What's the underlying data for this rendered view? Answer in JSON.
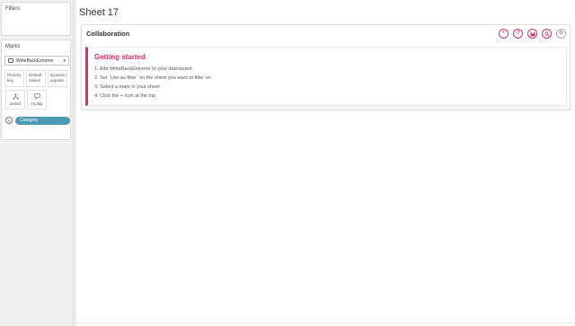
{
  "left_panel": {
    "filters_title": "Filters",
    "marks_title": "Marks",
    "mark_type": "WriteBackExtreme",
    "shelves": {
      "primary": "Primary key",
      "defaults": "Default values",
      "dynamic": "Dynamic populat..",
      "detail": "Detail",
      "tooltip": "Tooltip"
    },
    "pill_prefix": "A",
    "pill_label": "Category"
  },
  "sheet": {
    "title": "Sheet 17"
  },
  "collaboration": {
    "title": "Collaboration",
    "toolbar_icons": [
      "plus-icon",
      "history-icon",
      "save-icon",
      "search-icon",
      "gear-icon"
    ],
    "accent": "#e0306c"
  },
  "getting_started": {
    "title": "Getting started",
    "steps": [
      "1. Add WriteBackExtreme to your dashboard",
      "2. Set `Use as filter` on the sheet you want to filter on.",
      "3. Select a mark in your sheet",
      "4. Click the + icon at the top"
    ]
  }
}
